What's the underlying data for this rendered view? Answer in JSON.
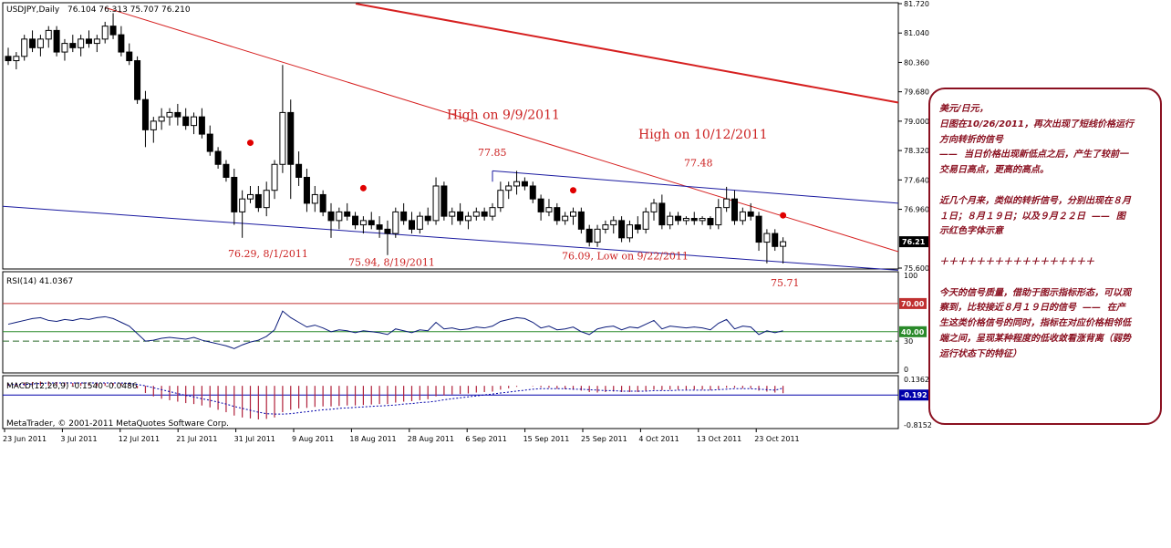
{
  "header": {
    "symbol": "USDJPY,Daily",
    "ohlc": "76.104 76.313 75.707 76.210"
  },
  "colors": {
    "bull": "#ffffff",
    "bear": "#000000",
    "trend_red": "#d62020",
    "channel_blue": "#1a1aa0",
    "annotation": "#cc2222",
    "note": "#8a1020",
    "rsi": "#0a1a7a",
    "macd_hist": "#b0203a",
    "signal": "#0000aa"
  },
  "chart_data": [
    {
      "type": "candlestick",
      "title": "USDJPY,Daily",
      "price_range": [
        75.6,
        81.72
      ],
      "y_ticks": [
        "81.720",
        "81.040",
        "80.360",
        "79.680",
        "79.000",
        "78.320",
        "77.640",
        "76.960",
        "75.600"
      ],
      "current_price_label": "76.21",
      "x_ticks": [
        "23 Jun 2011",
        "3 Jul 2011",
        "12 Jul 2011",
        "21 Jul 2011",
        "31 Jul 2011",
        "9 Aug 2011",
        "18 Aug 2011",
        "28 Aug 2011",
        "6 Sep 2011",
        "15 Sep 2011",
        "25 Sep 2011",
        "4 Oct 2011",
        "13 Oct 2011",
        "23 Oct 2011"
      ],
      "candles": [
        [
          80.5,
          80.7,
          80.3,
          80.4
        ],
        [
          80.4,
          80.6,
          80.2,
          80.5
        ],
        [
          80.5,
          81.0,
          80.4,
          80.9
        ],
        [
          80.9,
          81.1,
          80.6,
          80.7
        ],
        [
          80.7,
          81.0,
          80.5,
          80.9
        ],
        [
          80.9,
          81.2,
          80.7,
          81.1
        ],
        [
          81.1,
          81.2,
          80.5,
          80.6
        ],
        [
          80.6,
          80.9,
          80.4,
          80.8
        ],
        [
          80.8,
          81.0,
          80.6,
          80.7
        ],
        [
          80.7,
          81.0,
          80.5,
          80.9
        ],
        [
          80.9,
          81.1,
          80.7,
          80.8
        ],
        [
          80.8,
          81.0,
          80.6,
          80.9
        ],
        [
          80.9,
          81.3,
          80.8,
          81.2
        ],
        [
          81.2,
          81.5,
          80.9,
          81.0
        ],
        [
          81.0,
          81.2,
          80.5,
          80.6
        ],
        [
          80.6,
          80.8,
          80.3,
          80.4
        ],
        [
          80.4,
          80.5,
          79.4,
          79.5
        ],
        [
          79.5,
          79.7,
          78.4,
          78.8
        ],
        [
          78.8,
          79.1,
          78.5,
          79.0
        ],
        [
          79.0,
          79.3,
          78.8,
          79.1
        ],
        [
          79.1,
          79.3,
          78.9,
          79.2
        ],
        [
          79.2,
          79.4,
          78.9,
          79.1
        ],
        [
          79.1,
          79.3,
          78.8,
          78.9
        ],
        [
          78.9,
          79.2,
          78.7,
          79.1
        ],
        [
          79.1,
          79.3,
          78.6,
          78.7
        ],
        [
          78.7,
          78.9,
          78.2,
          78.3
        ],
        [
          78.3,
          78.4,
          77.9,
          78.0
        ],
        [
          78.0,
          78.1,
          77.6,
          77.7
        ],
        [
          77.7,
          77.9,
          76.6,
          76.9
        ],
        [
          76.9,
          77.4,
          76.3,
          77.2
        ],
        [
          77.2,
          77.5,
          77.1,
          77.3
        ],
        [
          77.3,
          77.5,
          76.9,
          77.0
        ],
        [
          77.0,
          77.6,
          76.8,
          77.4
        ],
        [
          77.4,
          78.1,
          77.2,
          78.0
        ],
        [
          78.0,
          80.3,
          77.8,
          79.2
        ],
        [
          79.2,
          79.5,
          77.2,
          78.0
        ],
        [
          78.0,
          78.3,
          77.5,
          77.7
        ],
        [
          77.7,
          77.9,
          76.9,
          77.1
        ],
        [
          77.1,
          77.5,
          76.9,
          77.3
        ],
        [
          77.3,
          77.4,
          76.8,
          76.9
        ],
        [
          76.9,
          77.1,
          76.3,
          76.7
        ],
        [
          76.7,
          77.0,
          76.5,
          76.9
        ],
        [
          76.9,
          77.1,
          76.7,
          76.8
        ],
        [
          76.8,
          76.9,
          76.5,
          76.6
        ],
        [
          76.6,
          76.8,
          76.4,
          76.7
        ],
        [
          76.7,
          76.9,
          76.5,
          76.6
        ],
        [
          76.6,
          76.8,
          76.3,
          76.5
        ],
        [
          76.5,
          76.7,
          75.9,
          76.4
        ],
        [
          76.4,
          77.0,
          76.3,
          76.9
        ],
        [
          76.9,
          77.1,
          76.6,
          76.7
        ],
        [
          76.7,
          76.9,
          76.4,
          76.5
        ],
        [
          76.5,
          76.9,
          76.4,
          76.8
        ],
        [
          76.8,
          77.0,
          76.6,
          76.7
        ],
        [
          76.7,
          77.7,
          76.6,
          77.5
        ],
        [
          77.5,
          77.6,
          76.7,
          76.8
        ],
        [
          76.8,
          77.0,
          76.6,
          76.9
        ],
        [
          76.9,
          77.1,
          76.6,
          76.7
        ],
        [
          76.7,
          76.9,
          76.5,
          76.8
        ],
        [
          76.8,
          77.0,
          76.7,
          76.9
        ],
        [
          76.9,
          77.0,
          76.7,
          76.8
        ],
        [
          76.8,
          77.1,
          76.7,
          77.0
        ],
        [
          77.0,
          77.6,
          76.9,
          77.4
        ],
        [
          77.4,
          77.6,
          77.2,
          77.5
        ],
        [
          77.5,
          77.85,
          77.3,
          77.6
        ],
        [
          77.6,
          77.7,
          77.4,
          77.5
        ],
        [
          77.5,
          77.6,
          77.1,
          77.2
        ],
        [
          77.2,
          77.3,
          76.7,
          76.9
        ],
        [
          76.9,
          77.2,
          76.8,
          77.0
        ],
        [
          77.0,
          77.1,
          76.6,
          76.7
        ],
        [
          76.7,
          76.9,
          76.6,
          76.8
        ],
        [
          76.8,
          77.0,
          76.6,
          76.9
        ],
        [
          76.9,
          77.0,
          76.4,
          76.5
        ],
        [
          76.5,
          76.6,
          76.1,
          76.2
        ],
        [
          76.2,
          76.6,
          76.09,
          76.5
        ],
        [
          76.5,
          76.7,
          76.4,
          76.6
        ],
        [
          76.6,
          76.8,
          76.4,
          76.7
        ],
        [
          76.7,
          76.8,
          76.2,
          76.3
        ],
        [
          76.3,
          76.7,
          76.2,
          76.6
        ],
        [
          76.6,
          76.8,
          76.4,
          76.5
        ],
        [
          76.5,
          77.0,
          76.4,
          76.9
        ],
        [
          76.9,
          77.2,
          76.7,
          77.1
        ],
        [
          77.1,
          77.3,
          76.5,
          76.6
        ],
        [
          76.6,
          76.9,
          76.5,
          76.8
        ],
        [
          76.8,
          76.9,
          76.6,
          76.7
        ],
        [
          76.7,
          76.8,
          76.6,
          76.75
        ],
        [
          76.75,
          76.9,
          76.6,
          76.7
        ],
        [
          76.7,
          76.8,
          76.6,
          76.75
        ],
        [
          76.75,
          76.8,
          76.5,
          76.6
        ],
        [
          76.6,
          77.2,
          76.5,
          77.0
        ],
        [
          77.0,
          77.48,
          76.9,
          77.2
        ],
        [
          77.2,
          77.4,
          76.6,
          76.7
        ],
        [
          76.7,
          77.0,
          76.6,
          76.9
        ],
        [
          76.9,
          77.1,
          76.7,
          76.8
        ],
        [
          76.8,
          76.9,
          76.0,
          76.2
        ],
        [
          76.2,
          76.5,
          75.71,
          76.4
        ],
        [
          76.4,
          76.5,
          76.0,
          76.1
        ],
        [
          76.104,
          76.313,
          75.707,
          76.21
        ]
      ],
      "annotations": {
        "high_9_9": "High on 9/9/2011",
        "high_10_12": "High on 10/12/2011",
        "p7785": "77.85",
        "p7748": "77.48",
        "low_8_1": "76.29, 8/1/2011",
        "low_8_19": "75.94,  8/19/2011",
        "low_9_22": "76.09,  Low on 9/22/2011",
        "p7571": "75.71"
      }
    },
    {
      "type": "line",
      "title": "RSI(14) 41.0367",
      "y_range": [
        0,
        100
      ],
      "y_ticks": [
        "100",
        "70.00",
        "40.00",
        "30",
        "0"
      ],
      "levels": [
        70,
        40,
        30
      ],
      "values": [
        48,
        50,
        52,
        54,
        55,
        52,
        51,
        53,
        52,
        54,
        53,
        55,
        56,
        54,
        50,
        46,
        38,
        30,
        31,
        33,
        34,
        33,
        32,
        34,
        31,
        29,
        27,
        25,
        22,
        26,
        29,
        31,
        35,
        42,
        62,
        55,
        50,
        45,
        47,
        44,
        40,
        42,
        41,
        39,
        41,
        40,
        39,
        37,
        43,
        41,
        39,
        42,
        41,
        50,
        43,
        44,
        42,
        43,
        45,
        44,
        46,
        51,
        53,
        55,
        54,
        50,
        44,
        46,
        42,
        43,
        45,
        40,
        37,
        43,
        45,
        46,
        42,
        45,
        44,
        48,
        52,
        43,
        46,
        45,
        44,
        45,
        44,
        42,
        49,
        53,
        43,
        46,
        45,
        37,
        41,
        39,
        41
      ]
    },
    {
      "type": "bar",
      "title": "MACD(12,26,9) -0.1540 -0.0486",
      "y_ticks": [
        "0.1362",
        "-0.192",
        "-0.8152"
      ],
      "y_range": [
        -0.8152,
        0.1362
      ],
      "macd": [
        0.05,
        0.06,
        0.07,
        0.08,
        0.09,
        0.09,
        0.08,
        0.07,
        0.06,
        0.06,
        0.05,
        0.05,
        0.06,
        0.06,
        0.05,
        0.03,
        -0.05,
        -0.15,
        -0.22,
        -0.27,
        -0.3,
        -0.33,
        -0.36,
        -0.38,
        -0.41,
        -0.45,
        -0.5,
        -0.55,
        -0.62,
        -0.66,
        -0.68,
        -0.7,
        -0.69,
        -0.66,
        -0.55,
        -0.5,
        -0.47,
        -0.46,
        -0.44,
        -0.43,
        -0.43,
        -0.42,
        -0.41,
        -0.41,
        -0.4,
        -0.39,
        -0.38,
        -0.38,
        -0.35,
        -0.33,
        -0.32,
        -0.3,
        -0.28,
        -0.22,
        -0.2,
        -0.18,
        -0.17,
        -0.16,
        -0.14,
        -0.13,
        -0.12,
        -0.08,
        -0.05,
        -0.02,
        0.0,
        -0.01,
        -0.03,
        -0.04,
        -0.06,
        -0.07,
        -0.08,
        -0.1,
        -0.13,
        -0.14,
        -0.13,
        -0.12,
        -0.13,
        -0.13,
        -0.13,
        -0.11,
        -0.08,
        -0.09,
        -0.08,
        -0.08,
        -0.08,
        -0.08,
        -0.08,
        -0.09,
        -0.07,
        -0.04,
        -0.04,
        -0.05,
        -0.05,
        -0.1,
        -0.12,
        -0.14,
        -0.154
      ],
      "signal": [
        0.02,
        0.03,
        0.03,
        0.04,
        0.05,
        0.06,
        0.06,
        0.06,
        0.06,
        0.06,
        0.06,
        0.06,
        0.06,
        0.06,
        0.06,
        0.05,
        0.03,
        0.0,
        -0.04,
        -0.08,
        -0.12,
        -0.16,
        -0.2,
        -0.23,
        -0.27,
        -0.3,
        -0.34,
        -0.38,
        -0.43,
        -0.47,
        -0.51,
        -0.55,
        -0.58,
        -0.59,
        -0.59,
        -0.58,
        -0.56,
        -0.54,
        -0.52,
        -0.5,
        -0.49,
        -0.47,
        -0.46,
        -0.45,
        -0.44,
        -0.43,
        -0.42,
        -0.41,
        -0.4,
        -0.38,
        -0.37,
        -0.35,
        -0.34,
        -0.32,
        -0.29,
        -0.27,
        -0.25,
        -0.23,
        -0.21,
        -0.19,
        -0.17,
        -0.15,
        -0.13,
        -0.11,
        -0.09,
        -0.07,
        -0.06,
        -0.06,
        -0.06,
        -0.06,
        -0.07,
        -0.07,
        -0.08,
        -0.09,
        -0.1,
        -0.1,
        -0.11,
        -0.11,
        -0.11,
        -0.11,
        -0.1,
        -0.1,
        -0.1,
        -0.09,
        -0.09,
        -0.09,
        -0.09,
        -0.09,
        -0.08,
        -0.07,
        -0.06,
        -0.06,
        -0.06,
        -0.07,
        -0.08,
        -0.09,
        -0.0486
      ]
    }
  ],
  "indicator_labels": {
    "rsi": "RSI(14) 41.0367",
    "macd": "MACD(12,26,9) -0.1540 -0.0486"
  },
  "copyright": "MetaTrader, © 2001-2011 MetaQuotes Software Corp.",
  "note": {
    "lines": [
      "美元/日元，",
      "日图在10/26/2011，再次出现了短线价格运行",
      "方向转折的信号",
      "——  当日价格出现新低点之后，产生了较前一",
      "交易日高点，更高的高点。",
      "",
      "近几个月来，类似的转折信号，分别出现在８月",
      "１日；８月１９日；以及９月２２日  ——  图",
      "示红色字体示意",
      "",
      "＋＋＋＋＋＋＋＋＋＋＋＋＋＋＋＋＋",
      "",
      "今天的信号质量，借助于图示指标形态，可以观",
      "察到，比较接近８月１９日的信号  ——  在产",
      "生这类价格信号的同时，指标在对应价格相邻低",
      "端之间，呈现某种程度的低收敛看涨背离（弱势",
      "运行状态下的特征）"
    ]
  }
}
